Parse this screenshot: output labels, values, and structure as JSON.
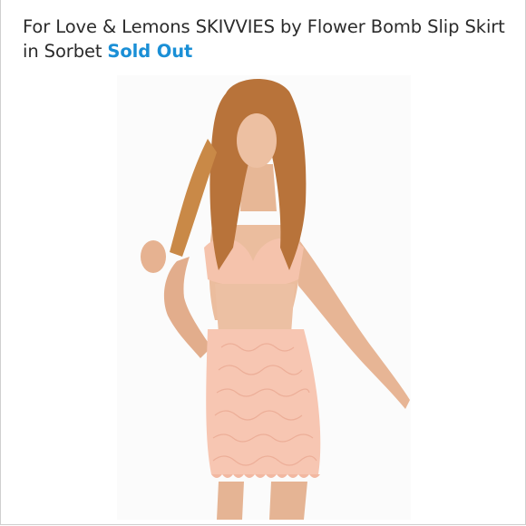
{
  "listing": {
    "title": "For Love & Lemons SKIVVIES by Flower Bomb Slip Skirt in Sorbet",
    "status": "Sold Out"
  },
  "colors": {
    "status": "#1a8fd6",
    "title_text": "#2b2b2b",
    "lace": "#f7c4b0",
    "hair": "#b9773f",
    "skin": "#e9b79a"
  },
  "icons": {
    "photo": "product-photo-model-in-lace-set"
  }
}
